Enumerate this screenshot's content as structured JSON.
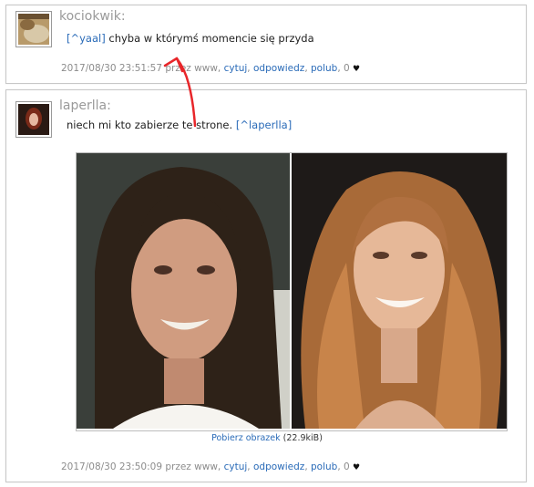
{
  "posts": [
    {
      "username": "kociokwik:",
      "mention": "[^yaal]",
      "text": " chyba w którymś momencie się przyda",
      "timestamp": "2017/08/30 23:51:57 przez www,",
      "actions": {
        "cytuj": "cytuj",
        "odpowiedz": "odpowiedz",
        "polub": "polub"
      },
      "likes": "0"
    },
    {
      "username": "laperlla:",
      "text": "niech mi kto zabierze te strone. ",
      "mention": "[^laperlla]",
      "download_label": "Pobierz obrazek",
      "download_size": "(22.9kiB)",
      "timestamp": "2017/08/30 23:50:09 przez www,",
      "actions": {
        "cytuj": "cytuj",
        "odpowiedz": "odpowiedz",
        "polub": "polub"
      },
      "likes": "0"
    }
  ],
  "colors": {
    "link": "#2a6bb8",
    "arrow": "#e8262a",
    "username": "#9a9a9a"
  },
  "icons": {
    "like": "heart-icon",
    "annotation": "red-arrow-annotation"
  }
}
